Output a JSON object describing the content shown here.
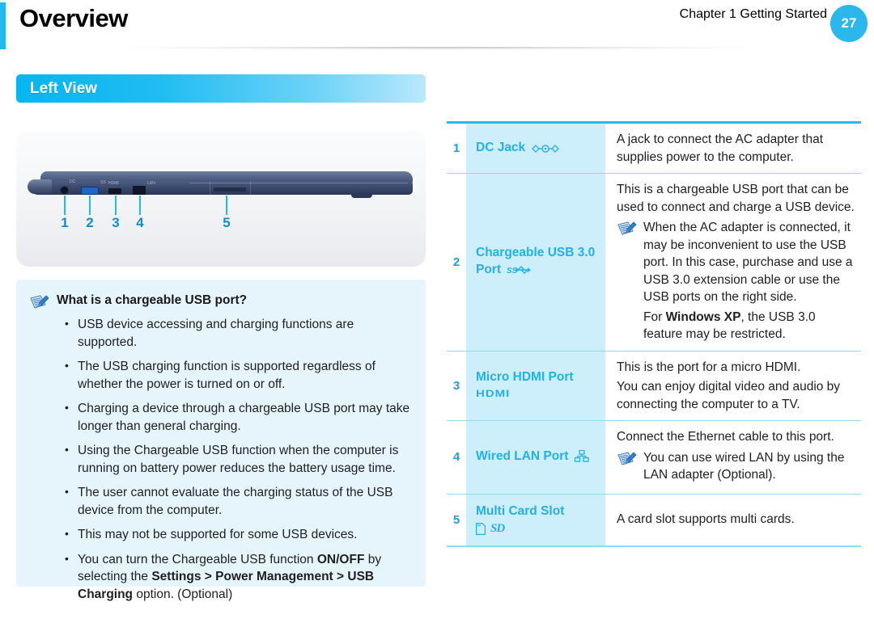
{
  "header": {
    "title": "Overview",
    "chapter": "Chapter 1",
    "section": "Getting Started",
    "page_number": "27",
    "accent_color": "#22b9f0"
  },
  "section": {
    "title": "Left View"
  },
  "figure": {
    "name": "laptop-left-side-view",
    "callouts": [
      "1",
      "2",
      "3",
      "4",
      "5"
    ],
    "port_marks": {
      "dc": "DC",
      "usb": "SS",
      "hdmi": "HDMI",
      "lan": "LAN"
    }
  },
  "note_box": {
    "title": "What is a chargeable USB port?",
    "icon": "notepad-pen-icon",
    "bullets": [
      "USB device accessing and charging functions are supported.",
      "The USB charging function is supported regardless of whether the power is turned on or off.",
      "Charging a device through a chargeable USB port may take longer than general charging.",
      "Using the Chargeable USB function when the computer is running on battery power reduces the battery usage time.",
      "The user cannot evaluate the charging status of the USB device from the computer.",
      "This may not be supported for some USB devices."
    ],
    "last_bullet": {
      "part1": "You can turn the Chargeable USB function ",
      "bold1": "ON/OFF",
      "part2": " by selecting the ",
      "bold2": "Settings > Power Management > USB Charging",
      "part3": " option. (Optional)"
    }
  },
  "spec_table": {
    "rows": [
      {
        "num": "1",
        "label": "DC Jack",
        "icon": "dc-jack-icon",
        "desc": [
          "A jack to connect the AC adapter that supplies power to the computer."
        ]
      },
      {
        "num": "2",
        "label": "Chargeable USB 3.0 Port",
        "icon": "usb-superspeed-icon",
        "desc": [
          "This is a chargeable USB port that can be used to connect and charge a USB device."
        ],
        "note": "When the AC adapter is connected, it may be inconvenient to use the USB port. In this case, purchase and use a USB 3.0 extension cable or use the USB ports on the right side.",
        "note_icon": "notepad-pen-icon",
        "extra": {
          "part1": "For ",
          "bold": "Windows XP",
          "part2": ", the USB 3.0 feature may be restricted."
        }
      },
      {
        "num": "3",
        "label": "Micro HDMI Port",
        "icon": "hdmi-logo",
        "icon_text": "HDMI",
        "desc": [
          "This is the port for a micro HDMI.",
          "You can enjoy digital video and audio by connecting the computer to a TV."
        ]
      },
      {
        "num": "4",
        "label": "Wired LAN Port",
        "icon": "lan-network-icon",
        "desc": [
          "Connect the Ethernet cable to this port."
        ],
        "note": "You can use wired LAN by using the LAN adapter (Optional).",
        "note_icon": "notepad-pen-icon"
      },
      {
        "num": "5",
        "label": "Multi Card Slot",
        "icon": "sd-card-icon",
        "icon_text": "SD",
        "desc": [
          "A card slot supports multi cards."
        ]
      }
    ]
  }
}
